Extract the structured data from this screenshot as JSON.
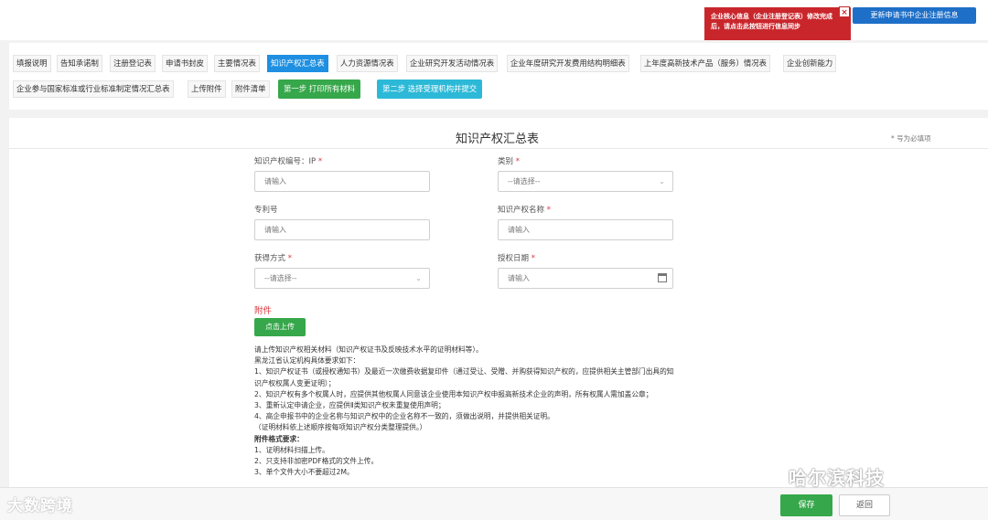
{
  "alert": {
    "text": "企业核心信息（企业注册登记表）修改完成后，请点击此按钮进行信息同步",
    "close_icon": "close-icon"
  },
  "sync_button": "更新申请书中企业注册信息",
  "tabs": [
    {
      "label": "填报说明",
      "active": false
    },
    {
      "label": "告知承诺制",
      "active": false
    },
    {
      "label": "注册登记表",
      "active": false
    },
    {
      "label": "申请书封皮",
      "active": false
    },
    {
      "label": "主要情况表",
      "active": false
    },
    {
      "label": "知识产权汇总表",
      "active": true
    },
    {
      "label": "人力资源情况表",
      "active": false
    },
    {
      "label": "企业研究开发活动情况表",
      "active": false
    },
    {
      "label": "企业年度研究开发费用结构明细表",
      "active": false
    },
    {
      "label": "上年度高新技术产品（服务）情况表",
      "active": false
    },
    {
      "label": "企业创新能力",
      "active": false
    },
    {
      "label": "企业参与国家标准或行业标准制定情况汇总表",
      "active": false
    },
    {
      "label": "上传附件",
      "active": false
    },
    {
      "label": "附件清单",
      "active": false
    }
  ],
  "steps": {
    "step1": "第一步 打印所有材料",
    "step2": "第二步 选择受理机构并提交"
  },
  "form": {
    "title": "知识产权汇总表",
    "required_note": "* 号为必填项",
    "fields": {
      "ip_number": {
        "label": "知识产权编号：IP",
        "required": "*",
        "placeholder": "请输入"
      },
      "category": {
        "label": "类别",
        "required": "*",
        "value": "--请选择--"
      },
      "patent_number": {
        "label": "专利号",
        "placeholder": "请输入"
      },
      "ip_name": {
        "label": "知识产权名称",
        "required": "*",
        "placeholder": "请输入"
      },
      "acquisition": {
        "label": "获得方式",
        "required": "*",
        "value": "--请选择--"
      },
      "grant_date": {
        "label": "授权日期",
        "required": "*",
        "placeholder": "请输入"
      }
    },
    "attachment_label": "附件",
    "upload_button": "点击上传",
    "notes": [
      "请上传知识产权相关材料（知识产权证书及反映技术水平的证明材料等）。",
      "黑龙江省认定机构具体要求如下：",
      "1、知识产权证书（或授权通知书）及最近一次缴费收据复印件（通过受让、受赠、并购获得知识产权的，应提供相关主管部门出具的知",
      "识产权权属人变更证明）；",
      "2、知识产权有多个权属人时，应提供其他权属人同意该企业使用本知识产权申报高新技术企业的声明，所有权属人需加盖公章；",
      "3、重新认定申请企业，应提供Ⅱ类知识产权未重复使用声明；",
      "4、高企申报书中的企业名称与知识产权中的企业名称不一致的，须做出说明，并提供相关证明。",
      "（证明材料依上述顺序按每项知识产权分类整理提供。）"
    ],
    "format_title": "附件格式要求：",
    "format_rules": [
      "1、证明材料扫描上传。",
      "2、只支持非加密PDF格式的文件上传。",
      "3、单个文件大小不要超过2M。"
    ]
  },
  "footer": {
    "save": "保存",
    "back": "返回"
  },
  "watermarks": {
    "left": "大数跨境",
    "right": "哈尔滨科技"
  }
}
